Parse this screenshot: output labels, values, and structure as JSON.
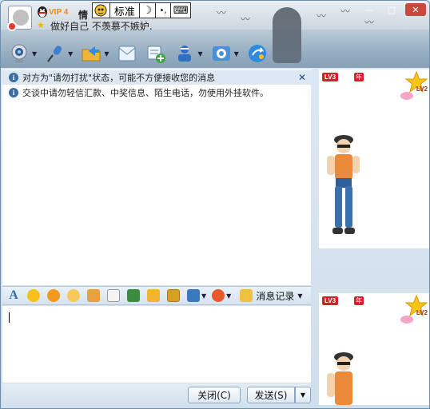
{
  "window": {
    "vip_label": "VIP 4",
    "nickname": "情",
    "signature": "做好自己 不羡慕不嫉妒.",
    "controls": [
      "—",
      "□",
      "✕"
    ]
  },
  "ime": {
    "mode": "标准",
    "moon": "☽",
    "punct": "•,",
    "keyboard": "⌨"
  },
  "toolbar": {
    "items": [
      {
        "name": "video-chat",
        "icon": "webcam-icon"
      },
      {
        "name": "voice-chat",
        "icon": "microphone-icon"
      },
      {
        "name": "send-file",
        "icon": "folder-icon"
      },
      {
        "name": "send-message",
        "icon": "email-icon"
      },
      {
        "name": "create-group",
        "icon": "add-group-icon"
      },
      {
        "name": "remote-assist",
        "icon": "remote-icon"
      },
      {
        "name": "apps",
        "icon": "apps-icon"
      },
      {
        "name": "share",
        "icon": "share-icon"
      }
    ]
  },
  "notices": {
    "status_notice": "对方为\"请勿打扰\"状态，可能不方便接收您的消息",
    "security_notice": "交谈中请勿轻信汇款、中奖信息、陌生电话，勿使用外挂软件。",
    "close_glyph": "✕"
  },
  "format_bar": {
    "font_glyph": "A",
    "history_label": "消息记录"
  },
  "buttons": {
    "close_label": "关闭(C)",
    "send_label": "发送(S)"
  },
  "show_panel": {
    "level_badge": "LV3",
    "year_badge": "年",
    "level2_badge": "LV2"
  },
  "colors": {
    "accent": "#2e6db4",
    "badge_red": "#d61f26",
    "vip_orange": "#f08a00"
  }
}
